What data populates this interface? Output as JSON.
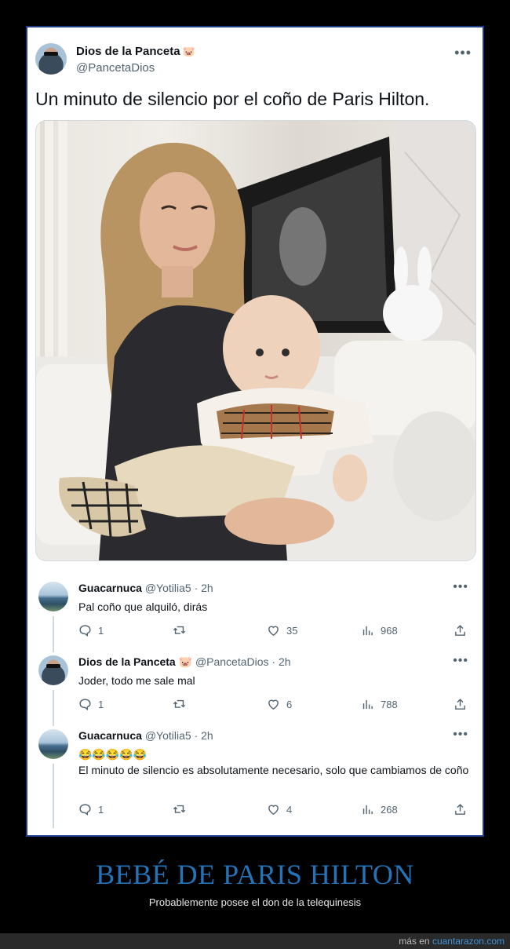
{
  "tweet": {
    "author_name": "Dios de la Panceta",
    "author_emoji": "🐷",
    "author_handle": "@PancetaDios",
    "more_icon": "more-dots-icon",
    "text": "Un minuto de silencio por el coño de Paris Hilton."
  },
  "replies": [
    {
      "name": "Guacarnuca",
      "handle": "@Yotilia5",
      "time": "· 2h",
      "text": "Pal coño que alquiló, dirás",
      "replies": "1",
      "likes": "35",
      "views": "968"
    },
    {
      "name": "Dios de la Panceta",
      "emoji": "🐷",
      "handle": "@PancetaDios",
      "time": "· 2h",
      "text": "Joder, todo me sale mal",
      "replies": "1",
      "likes": "6",
      "views": "788"
    },
    {
      "name": "Guacarnuca",
      "handle": "@Yotilia5",
      "time": "· 2h",
      "emoji_line": "😂😂😂😂😂",
      "text": "El minuto de silencio es absolutamente necesario, solo que cambiamos de coño",
      "replies": "1",
      "likes": "4",
      "views": "268"
    }
  ],
  "caption": {
    "title": "BEBÉ DE PARIS HILTON",
    "subtitle": "Probablemente posee el don de la telequinesis"
  },
  "footer": {
    "prefix": "más en",
    "link": "cuantarazon.com"
  },
  "colors": {
    "background": "#000000",
    "frame_border": "#1e3c8c",
    "caption_title": "#2473b8",
    "link": "#3f93d8"
  }
}
